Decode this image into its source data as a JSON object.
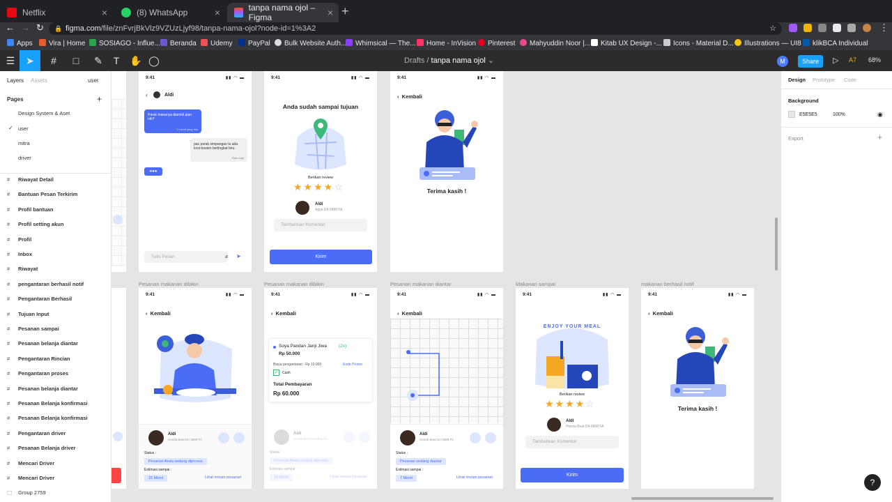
{
  "browser": {
    "tabs": [
      {
        "label": "Netflix",
        "active": false
      },
      {
        "label": "(8) WhatsApp",
        "active": false
      },
      {
        "label": "tanpa nama ojol – Figma",
        "active": true
      }
    ],
    "url_domain": "figma.com",
    "url_path": "/file/znFvrjBkVlz9VZUzLjyf98/tanpa-nama-ojol?node-id=1%3A2",
    "bookmarks": [
      "Apps",
      "Vira | Home",
      "SOSIAGO - Influe...",
      "Beranda",
      "Udemy",
      "PayPal",
      "Bulk Website Auth...",
      "Whimsical — The...",
      "Home - InVision",
      "Pinterest",
      "Mahyuddin Noor |...",
      "Kitab UX Design -...",
      "Icons - Material D...",
      "Illustrations — UI8",
      "klikBCA Individual"
    ]
  },
  "figma": {
    "breadcrumb_parent": "Drafts",
    "breadcrumb_file": "tanpa nama ojol",
    "avatar_initial": "M",
    "share_label": "Share",
    "zoom": "68%",
    "a7": "A7"
  },
  "left_panel": {
    "tabs": [
      "Layers",
      "Assets"
    ],
    "page_selector": "user",
    "pages_title": "Pages",
    "pages": [
      "Design System & Aset",
      "user",
      "mitra",
      "driver"
    ],
    "current_page": "user",
    "layers": [
      "Riwayat Detail",
      "Bantuan Pesan Terkirim",
      "Profil bantuan",
      "Profil setting akun",
      "Profil",
      "Inbox",
      "Riwayat",
      "pengantaran berhasil notif",
      "Pengantaran Berhasil",
      "Tujuan Input",
      "Pesanan sampai",
      "Pesanan belanja diantar",
      "Pengantaran Rincian",
      "Pengantaran proses",
      "Pesanan belanja diantar",
      "Pesanan Belanja konfirmasi",
      "Pesanan Belanja konfirmasi",
      "Pengantaran driver",
      "Pesanan Belanja driver",
      "Mencari Driver",
      "Mencari Driver",
      "Group 2759"
    ]
  },
  "right_panel": {
    "tabs": [
      "Design",
      "Prototype",
      "Code"
    ],
    "background_label": "Background",
    "bg_hex": "E5E5E5",
    "bg_opacity": "100%",
    "export_label": "Export"
  },
  "frames": {
    "time": "9:41",
    "chat": {
      "name": "Aldi",
      "msg_in": "Parak mananya diambil pian nih?",
      "msg_in_time": "1 menit yang lalu",
      "msg_out": "pas parak simpangan tu ada kost-kosten berlingkat biru.",
      "msg_out_status": "Baru saja",
      "input_placeholder": "Tulis Pesan"
    },
    "arrived": {
      "title": "Anda sudah sampai tujuan",
      "review": "Berikan review",
      "driver": "Aldi",
      "plate": "Agya DA 6888 FA",
      "comment_placeholder": "Tambahkan Komentar",
      "send": "Kirim"
    },
    "thanks": {
      "back": "Kembali",
      "message": "Terima kasih !"
    },
    "bottom_labels": [
      "Pesanan makanan dibikin",
      "Pesanan makanan dibikin",
      "Pesanan makanan diantar",
      "Makanan sampai",
      "makanan berhasil notif"
    ],
    "cooking": {
      "back": "Kembali",
      "driver": "Aldi",
      "vehicle": "Honda Beat DA 6888 FA",
      "status_label": "Status :",
      "status_chip": "Pesanan Anda sedang diproses",
      "eta_label": "Estimasi sampai :",
      "eta_chip": "15 Menit",
      "details_link": "Lihat rincian pesanan"
    },
    "order": {
      "back": "Kembali",
      "item": "Soya Pandan Janji Jiwa",
      "qty": "(2x)",
      "price": "Rp 50.000",
      "delivery": "Biaya pengantaran : Rp 10.000",
      "promo": "Kode Promo",
      "payment": "Cash",
      "total_label": "Total Pembayaran",
      "total": "Rp 60.000",
      "driver": "Aldi",
      "vehicle": "Honda Beat DA 6888 FA",
      "status_label": "Status :",
      "status_chip": "Pesanan Anda sedang diproses",
      "eta_label": "Estimasi sampai :",
      "eta_chip": "15 Menit",
      "details_link": "Lihat rincian pesanan"
    },
    "delivering": {
      "back": "Kembali",
      "driver": "Aldi",
      "vehicle": "Honda Beat DA 6888 FA",
      "status_label": "Status :",
      "status_chip": "Pesanan sedang diantar",
      "eta_label": "Estimasi sampai :",
      "eta_chip": "7 Menit",
      "details_link": "Lihat rincian pesanan"
    },
    "food_arrived": {
      "banner": "ENJOY YOUR MEAL",
      "review": "Berikan review",
      "driver": "Aldi",
      "vehicle": "Honda Beat DA 6888 FA",
      "comment_placeholder": "Tambahkan Komentar",
      "send": "Kirim"
    },
    "notif": {
      "back": "Kembali",
      "message": "Terima kasih !"
    }
  },
  "colors": {
    "primary": "#4a6cf7",
    "figma_blue": "#18a0fb",
    "star": "#f5a623"
  }
}
